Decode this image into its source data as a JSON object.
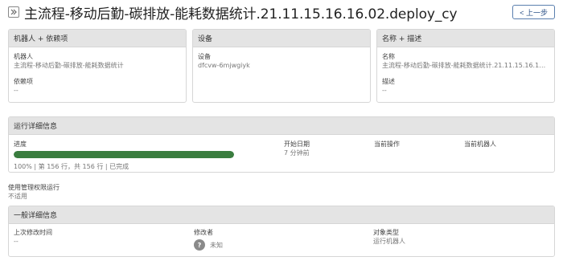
{
  "header": {
    "title": "主流程-移动后勤-碳排放-能耗数据统计.21.11.15.16.16.02.deploy_cy",
    "back_label": "< 上一步"
  },
  "robot_card": {
    "header": "机器人 + 依赖项",
    "robot_label": "机器人",
    "robot_value": "主流程-移动后勤-碳排放-能耗数据统计",
    "deps_label": "依赖项",
    "deps_value": "--"
  },
  "device_card": {
    "header": "设备",
    "device_label": "设备",
    "device_value": "dfcvw-6mjwgiyk"
  },
  "name_card": {
    "header": "名称 + 描述",
    "name_label": "名称",
    "name_value": "主流程-移动后勤-碳排放-能耗数据统计.21.11.15.16.16.0...",
    "desc_label": "描述",
    "desc_value": "--"
  },
  "run_details": {
    "header": "运行详细信息",
    "progress_label": "进度",
    "progress_percent": 100,
    "progress_text": "100% | 第 156 行，共 156 行 | 已完成",
    "start_label": "开始日期",
    "start_value": "7 分钟前",
    "current_action_label": "当前操作",
    "current_robot_label": "当前机器人"
  },
  "admin_run": {
    "label": "使用管理权限运行",
    "value": "不适用"
  },
  "general": {
    "header": "一般详细信息",
    "modified_label": "上次修改时间",
    "modified_value": "--",
    "modifier_label": "修改者",
    "modifier_avatar": "?",
    "modifier_value": "未知",
    "object_type_label": "对象类型",
    "object_type_value": "运行机器人"
  },
  "colors": {
    "progress_fill": "#3a7d3f",
    "header_bg": "#e4e4e4",
    "accent": "#2a4f86"
  }
}
